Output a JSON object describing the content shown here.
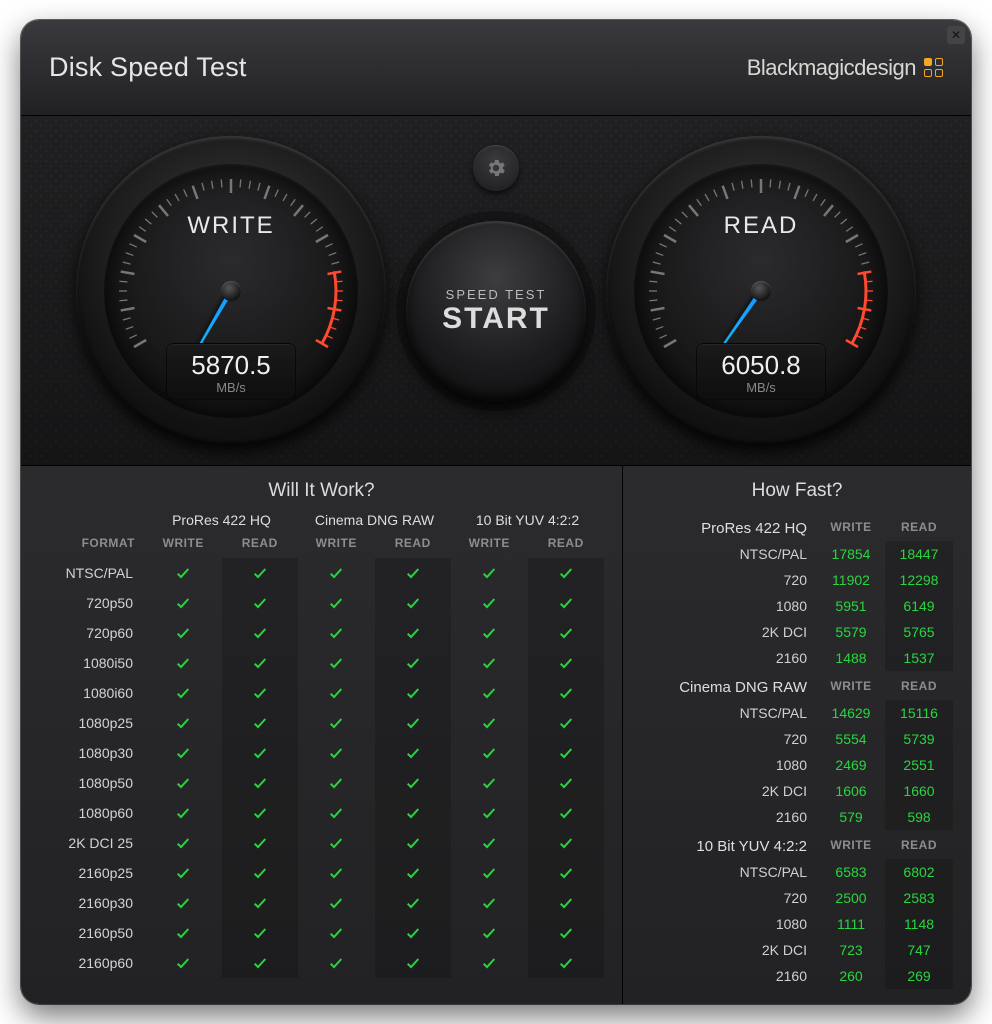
{
  "header": {
    "title": "Disk Speed Test",
    "brand": "Blackmagicdesign"
  },
  "gauges": {
    "write": {
      "label": "WRITE",
      "value": "5870.5",
      "unit": "MB/s",
      "needle_deg": 120
    },
    "read": {
      "label": "READ",
      "value": "6050.8",
      "unit": "MB/s",
      "needle_deg": 125
    }
  },
  "center": {
    "settings_icon": "gear-icon",
    "start_small": "SPEED TEST",
    "start_big": "START"
  },
  "willItWork": {
    "title": "Will It Work?",
    "formatHeader": "FORMAT",
    "subHeaders": [
      "WRITE",
      "READ"
    ],
    "codecs": [
      "ProRes 422 HQ",
      "Cinema DNG RAW",
      "10 Bit YUV 4:2:2"
    ],
    "rows": [
      {
        "label": "NTSC/PAL",
        "cells": [
          true,
          true,
          true,
          true,
          true,
          true
        ]
      },
      {
        "label": "720p50",
        "cells": [
          true,
          true,
          true,
          true,
          true,
          true
        ]
      },
      {
        "label": "720p60",
        "cells": [
          true,
          true,
          true,
          true,
          true,
          true
        ]
      },
      {
        "label": "1080i50",
        "cells": [
          true,
          true,
          true,
          true,
          true,
          true
        ]
      },
      {
        "label": "1080i60",
        "cells": [
          true,
          true,
          true,
          true,
          true,
          true
        ]
      },
      {
        "label": "1080p25",
        "cells": [
          true,
          true,
          true,
          true,
          true,
          true
        ]
      },
      {
        "label": "1080p30",
        "cells": [
          true,
          true,
          true,
          true,
          true,
          true
        ]
      },
      {
        "label": "1080p50",
        "cells": [
          true,
          true,
          true,
          true,
          true,
          true
        ]
      },
      {
        "label": "1080p60",
        "cells": [
          true,
          true,
          true,
          true,
          true,
          true
        ]
      },
      {
        "label": "2K DCI 25",
        "cells": [
          true,
          true,
          true,
          true,
          true,
          true
        ]
      },
      {
        "label": "2160p25",
        "cells": [
          true,
          true,
          true,
          true,
          true,
          true
        ]
      },
      {
        "label": "2160p30",
        "cells": [
          true,
          true,
          true,
          true,
          true,
          true
        ]
      },
      {
        "label": "2160p50",
        "cells": [
          true,
          true,
          true,
          true,
          true,
          true
        ]
      },
      {
        "label": "2160p60",
        "cells": [
          true,
          true,
          true,
          true,
          true,
          true
        ]
      }
    ]
  },
  "howFast": {
    "title": "How Fast?",
    "subHeaders": [
      "WRITE",
      "READ"
    ],
    "groups": [
      {
        "name": "ProRes 422 HQ",
        "rows": [
          {
            "label": "NTSC/PAL",
            "write": "17854",
            "read": "18447"
          },
          {
            "label": "720",
            "write": "11902",
            "read": "12298"
          },
          {
            "label": "1080",
            "write": "5951",
            "read": "6149"
          },
          {
            "label": "2K DCI",
            "write": "5579",
            "read": "5765"
          },
          {
            "label": "2160",
            "write": "1488",
            "read": "1537"
          }
        ]
      },
      {
        "name": "Cinema DNG RAW",
        "rows": [
          {
            "label": "NTSC/PAL",
            "write": "14629",
            "read": "15116"
          },
          {
            "label": "720",
            "write": "5554",
            "read": "5739"
          },
          {
            "label": "1080",
            "write": "2469",
            "read": "2551"
          },
          {
            "label": "2K DCI",
            "write": "1606",
            "read": "1660"
          },
          {
            "label": "2160",
            "write": "579",
            "read": "598"
          }
        ]
      },
      {
        "name": "10 Bit YUV 4:2:2",
        "rows": [
          {
            "label": "NTSC/PAL",
            "write": "6583",
            "read": "6802"
          },
          {
            "label": "720",
            "write": "2500",
            "read": "2583"
          },
          {
            "label": "1080",
            "write": "1111",
            "read": "1148"
          },
          {
            "label": "2K DCI",
            "write": "723",
            "read": "747"
          },
          {
            "label": "2160",
            "write": "260",
            "read": "269"
          }
        ]
      }
    ]
  }
}
